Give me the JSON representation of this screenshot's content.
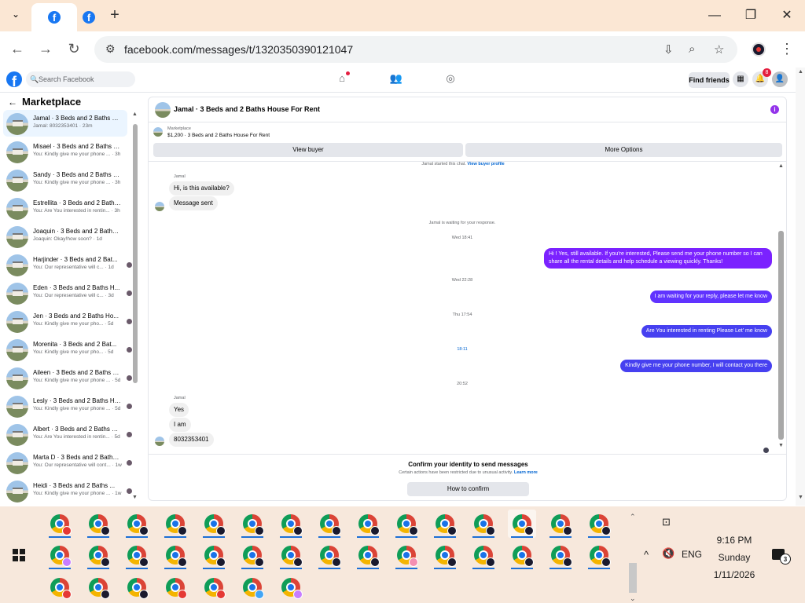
{
  "browser": {
    "url": "facebook.com/messages/t/1320350390121047",
    "tab_icons": [
      "facebook-icon",
      "facebook-icon"
    ]
  },
  "fb_header": {
    "search_placeholder": "Search Facebook",
    "find_friends": "Find friends",
    "notification_count": "8"
  },
  "sidebar": {
    "title": "Marketplace",
    "conversations": [
      {
        "name": "Jamal · 3 Beds and 2 Baths Ho...",
        "preview": "Jamal: 8032353401 · 23m",
        "active": true
      },
      {
        "name": "Misael · 3 Beds and 2 Baths H...",
        "preview": "You: Kindly give me your phone ... · 3h"
      },
      {
        "name": "Sandy · 3 Beds and 2 Baths H...",
        "preview": "You: Kindly give me your phone ... · 3h"
      },
      {
        "name": "Estrellita · 3 Beds and 2 Baths ...",
        "preview": "You: Are You interested in rentin... · 3h"
      },
      {
        "name": "Joaquin · 3 Beds and 2 Baths ...",
        "preview": "Joaquin: Okay!how soon? · 1d"
      },
      {
        "name": "Harjinder · 3 Beds and 2 Bat...",
        "preview": "You: Our representative will c... · 1d"
      },
      {
        "name": "Eden · 3 Beds and 2 Baths H...",
        "preview": "You: Our representative will c... · 3d"
      },
      {
        "name": "Jen · 3 Beds and 2 Baths Ho...",
        "preview": "You: Kindly give me your pho... · 5d"
      },
      {
        "name": "Morenita · 3 Beds and 2 Bat...",
        "preview": "You: Kindly give me your pho... · 5d"
      },
      {
        "name": "Aileen · 3 Beds and 2 Baths H...",
        "preview": "You: Kindly give me your phone ... · 5d"
      },
      {
        "name": "Lesly · 3 Beds and 2 Baths Ho...",
        "preview": "You: Kindly give me your phone ... · 5d"
      },
      {
        "name": "Albert · 3 Beds and 2 Baths H...",
        "preview": "You: Are You interested in rentin... · 5d"
      },
      {
        "name": "Marta D · 3 Beds and 2 Baths ...",
        "preview": "You: Our representative will cont... · 1w"
      },
      {
        "name": "Heidi · 3 Beds and 2 Baths ...",
        "preview": "You: Kindly give me your phone ... · 1w"
      }
    ]
  },
  "chat": {
    "title": "Jamal · 3 Beds and 2 Baths House For Rent",
    "listing_source": "Marketplace",
    "listing_price": "$1,200 · 3 Beds and 2 Baths House For Rent",
    "view_buyer": "View buyer",
    "more_options": "More Options",
    "started_text": "Jamal started this chat.",
    "view_buyer_profile": "View buyer profile",
    "sender_name": "Jamal",
    "msg_is_available": "Hi, is this available?",
    "msg_sent": "Message sent",
    "waiting": "Jamal is waiting for your response.",
    "ts1": "Wed 18:41",
    "out1": "Hi ! Yes, still available. If you're interested, Please send me your phone number so I can share all the rental details and help schedule a viewing quickly. Thanks!",
    "ts2": "Wed 22:28",
    "out2": "I am waiting for your reply, please let me know",
    "ts3": "Thu 17:54",
    "out3": "Are You  interested in renting Please Let' me know",
    "ts4": "18:11",
    "out4": "Kindly give me your phone number, I will contact you there",
    "ts5": "20:52",
    "sender_name2": "Jamal",
    "in_yes": "Yes",
    "in_iam": "I am",
    "in_phone": "8032353401",
    "confirm_title": "Confirm your identity to send messages",
    "confirm_sub": "Certain actions have been restricted due to unusual activity.",
    "learn_more": "Learn more",
    "how_to_confirm": "How to confirm"
  },
  "taskbar": {
    "time": "9:16 PM",
    "day": "Sunday",
    "date": "1/11/2026",
    "lang": "ENG",
    "notif_count": "3",
    "overlay_colors": [
      "#e53935",
      "#1a1a2e",
      "#1a1a2e",
      "#1a1a2e",
      "#1a1a2e",
      "#1a1a2e",
      "#1a1a2e",
      "#1a1a2e",
      "#1a1a2e",
      "#1a1a2e",
      "#1a1a2e",
      "#1a1a2e",
      "#1a1a2e",
      "#1a1a2e",
      "#1a1a2e",
      "#c77dff",
      "#1a1a2e",
      "#1a1a2e",
      "#1a1a2e",
      "#1a1a2e",
      "#1a1a2e",
      "#1a1a2e",
      "#1a1a2e",
      "#1a1a2e",
      "#f48fb1",
      "#1a1a2e",
      "#1a1a2e",
      "#1a1a2e",
      "#1a1a2e",
      "#1a1a2e",
      "#e53935",
      "#1a1a2e",
      "#1a1a2e",
      "#e53935",
      "#e53935",
      "#42a5f5",
      "#c77dff"
    ]
  }
}
